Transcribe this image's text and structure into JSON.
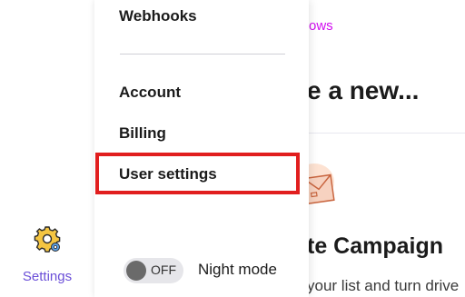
{
  "rail": {
    "settings_label": "Settings",
    "settings_icon": "gear-icon"
  },
  "menu": {
    "items": [
      {
        "label": "Webhooks"
      },
      {
        "label": "Account"
      },
      {
        "label": "Billing"
      },
      {
        "label": "User settings"
      }
    ],
    "night_mode": {
      "state": "OFF",
      "label": "Night mode"
    }
  },
  "background": {
    "link_text": "ows",
    "heading": "e a new...",
    "card_title": "te Campaign",
    "card_description": "your list and turn drive"
  },
  "colors": {
    "accent": "#6b4fd8",
    "link": "#d10ff0",
    "highlight": "#e11e1e"
  }
}
